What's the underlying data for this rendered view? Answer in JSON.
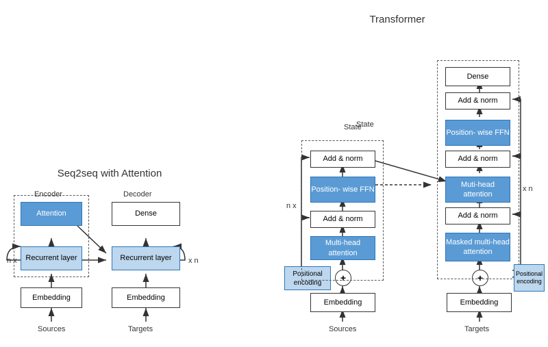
{
  "title_seq2seq": "Seq2seq with Attention",
  "title_transformer": "Transformer",
  "encoder_label": "Encoder",
  "decoder_label": "Decoder",
  "state_label": "State",
  "nx_label_seq": "n x",
  "xn_label_seq": "x n",
  "nx_label_trans": "n x",
  "xn_label_trans": "x n",
  "sources_label_1": "Sources",
  "targets_label_1": "Targets",
  "sources_label_2": "Sources",
  "targets_label_3": "Targets",
  "boxes": {
    "seq_attention": "Attention",
    "seq_enc_recurrent": "Recurrent layer",
    "seq_enc_embedding": "Embedding",
    "seq_dec_dense": "Dense",
    "seq_dec_recurrent": "Recurrent layer",
    "seq_dec_embedding": "Embedding",
    "trans_enc_pos": "Positional\nencoding",
    "trans_enc_embedding": "Embedding",
    "trans_enc_multihead": "Multi-head\nattention",
    "trans_enc_addnorm1": "Add & norm",
    "trans_enc_poswise": "Position-\nwise FFN",
    "trans_enc_addnorm2": "Add & norm",
    "trans_dec_pos": "Positional\nencoding",
    "trans_dec_embedding": "Embedding",
    "trans_dec_masked": "Masked\nmulti-head\nattention",
    "trans_dec_addnorm1": "Add & norm",
    "trans_dec_multihead": "Muti-head\nattention",
    "trans_dec_addnorm2": "Add & norm",
    "trans_dec_poswise": "Position-\nwise FFN",
    "trans_dec_addnorm3": "Add & norm",
    "trans_dec_dense": "Dense"
  }
}
